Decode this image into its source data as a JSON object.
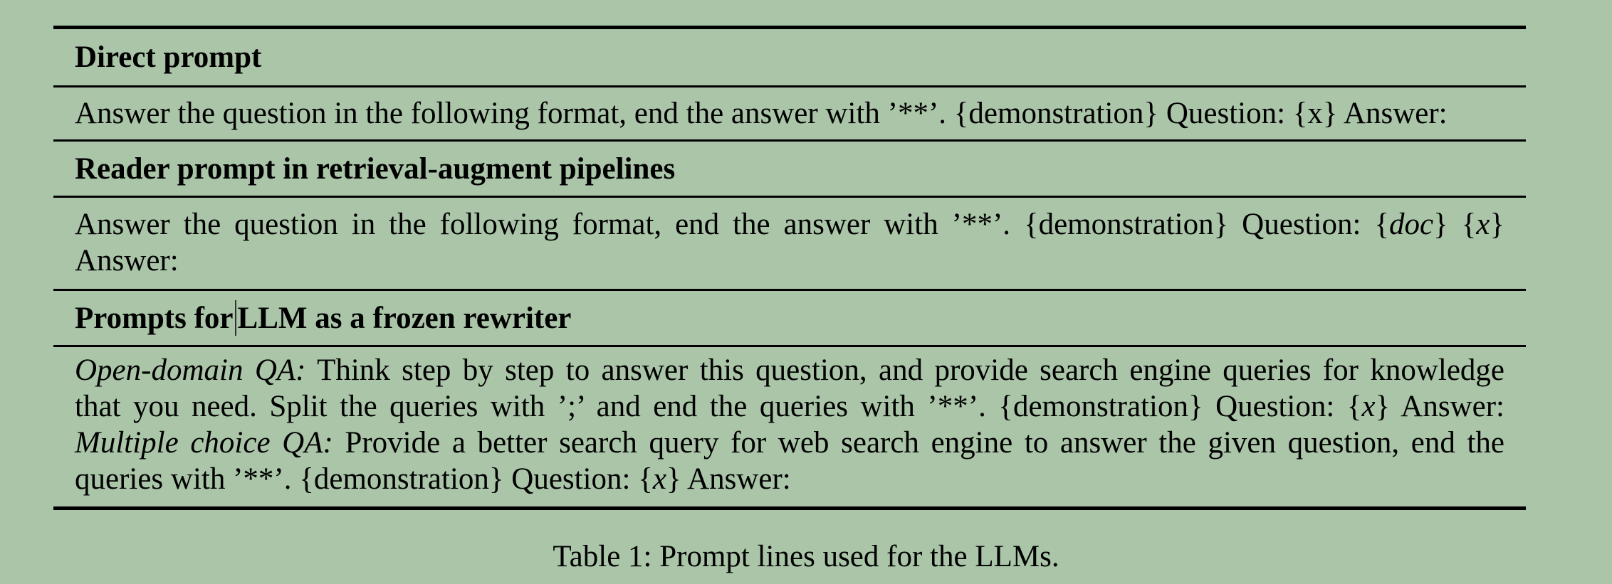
{
  "table": {
    "sections": [
      {
        "heading": "Direct prompt",
        "text": "Answer the question in the following format, end the answer with ’**’. {demonstration} Question: {x} Answer:"
      },
      {
        "heading": "Reader prompt in retrieval-augment pipelines",
        "line1_prefix": "Answer the question in the following format, end the answer with ’**’. {demonstration} Question: {",
        "line1_doc": "doc",
        "line1_mid": "} {",
        "line1_x": "x",
        "line1_suffix": "}",
        "line2": "Answer:"
      },
      {
        "heading_part1": "Prompts for",
        "heading_part2": "LLM as a frozen rewriter",
        "odqa_label": "Open-domain QA:",
        "odqa_line1": "Think step by step to answer this question, and provide search engine queries for knowledge",
        "odqa_line2_prefix": "that you need. Split the queries with ’;’ and end the queries with ’**’. {demonstration} Question: {",
        "odqa_line2_x": "x",
        "odqa_line2_suffix": "} Answer:",
        "mcqa_label": "Multiple choice QA:",
        "mcqa_line1": "Provide a better search query for web search engine to answer the given question, end the",
        "mcqa_line2_prefix": "queries with ’**’. {demonstration} Question: {",
        "mcqa_line2_x": "x",
        "mcqa_line2_suffix": "} Answer:"
      }
    ]
  },
  "caption": "Table 1: Prompt lines used for the LLMs."
}
